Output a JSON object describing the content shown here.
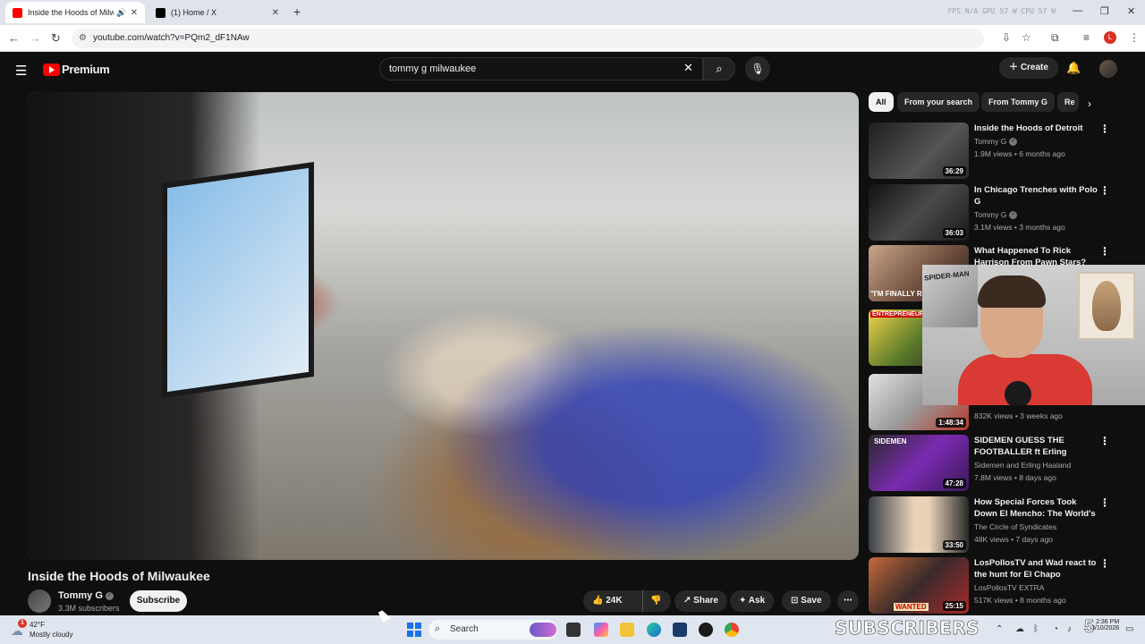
{
  "browser": {
    "tabs": [
      {
        "title": "Inside the Hoods of Milwaukee",
        "favicon_color": "#ff0000",
        "active": true
      },
      {
        "title": "(1) Home / X",
        "favicon_color": "#000000",
        "active": false
      }
    ],
    "url": "youtube.com/watch?v=PQm2_dF1NAw",
    "sys_stats": "FPS N/A    GPU 57 W    CPU 57 W",
    "profile_letter": "L"
  },
  "youtube": {
    "logo_text": "Premium",
    "search_query": "tommy g milwaukee",
    "create_label": "Create",
    "video": {
      "title": "Inside the Hoods of Milwaukee",
      "channel": "Tommy G",
      "subscribers": "3.3M subscribers",
      "subscribe_label": "Subscribe",
      "likes": "24K",
      "share_label": "Share",
      "ask_label": "Ask",
      "save_label": "Save"
    },
    "chips": [
      "All",
      "From your search",
      "From Tommy G",
      "Re"
    ],
    "recommendations": [
      {
        "title": "Inside the Hoods of Detroit",
        "channel": "Tommy G",
        "meta": "1.9M views • 6 months ago",
        "duration": "36:29",
        "thumb": "#3a3a3a"
      },
      {
        "title": "In Chicago Trenches with Polo G",
        "channel": "Tommy G",
        "meta": "3.1M views • 3 months ago",
        "duration": "36:03",
        "thumb": "#2b2b2b"
      },
      {
        "title": "What Happened To Rick Harrison From Pawn Stars? He...",
        "channel": "",
        "meta": "",
        "duration": "",
        "thumb": "#6a4a3a"
      },
      {
        "title": "",
        "channel": "",
        "meta": "",
        "duration": "",
        "thumb": "#4a5a2a"
      },
      {
        "title": "",
        "channel": "",
        "meta": "832K views • 3 weeks ago",
        "duration": "1:48:34",
        "thumb": "#8a8a8a"
      },
      {
        "title": "SIDEMEN GUESS THE FOOTBALLER ft Erling Haaland",
        "channel": "Sidemen and Erling Haaland",
        "meta": "7.8M views • 8 days ago",
        "duration": "47:28",
        "thumb": "#5a2a8a"
      },
      {
        "title": "How Special Forces Took Down El Mencho: The World's Most ...",
        "channel": "The Circle of Syndicates",
        "meta": "48K views • 7 days ago",
        "duration": "33:50",
        "thumb": "#3a3a3a"
      },
      {
        "title": "LosPollosTV and Wad react to the hunt for El Chapo",
        "channel": "LosPollosTV EXTRA",
        "meta": "517K views • 8 months ago",
        "duration": "25:15",
        "thumb": "#8a3a2a"
      }
    ],
    "rec_thumb_labels": [
      "",
      "",
      "\"I'M FINALLY RE",
      "ENTREPRENEUR",
      "",
      "SIDEMEN",
      "",
      "WANTED"
    ]
  },
  "overlay": {
    "poster_text": "SPIDER-MAN"
  },
  "taskbar": {
    "notification_count": "1",
    "temperature": "42°F",
    "condition": "Mostly cloudy",
    "search_placeholder": "Search",
    "banner_text": "SUBSCRIBERS",
    "banner_count": "5",
    "time": "2:36 PM",
    "date": "3/10/2026"
  },
  "colors": {
    "yt_red": "#ff0000",
    "background": "#0f0f0f",
    "chip_bg": "#272727",
    "taskbar": "#dfe6ef"
  }
}
